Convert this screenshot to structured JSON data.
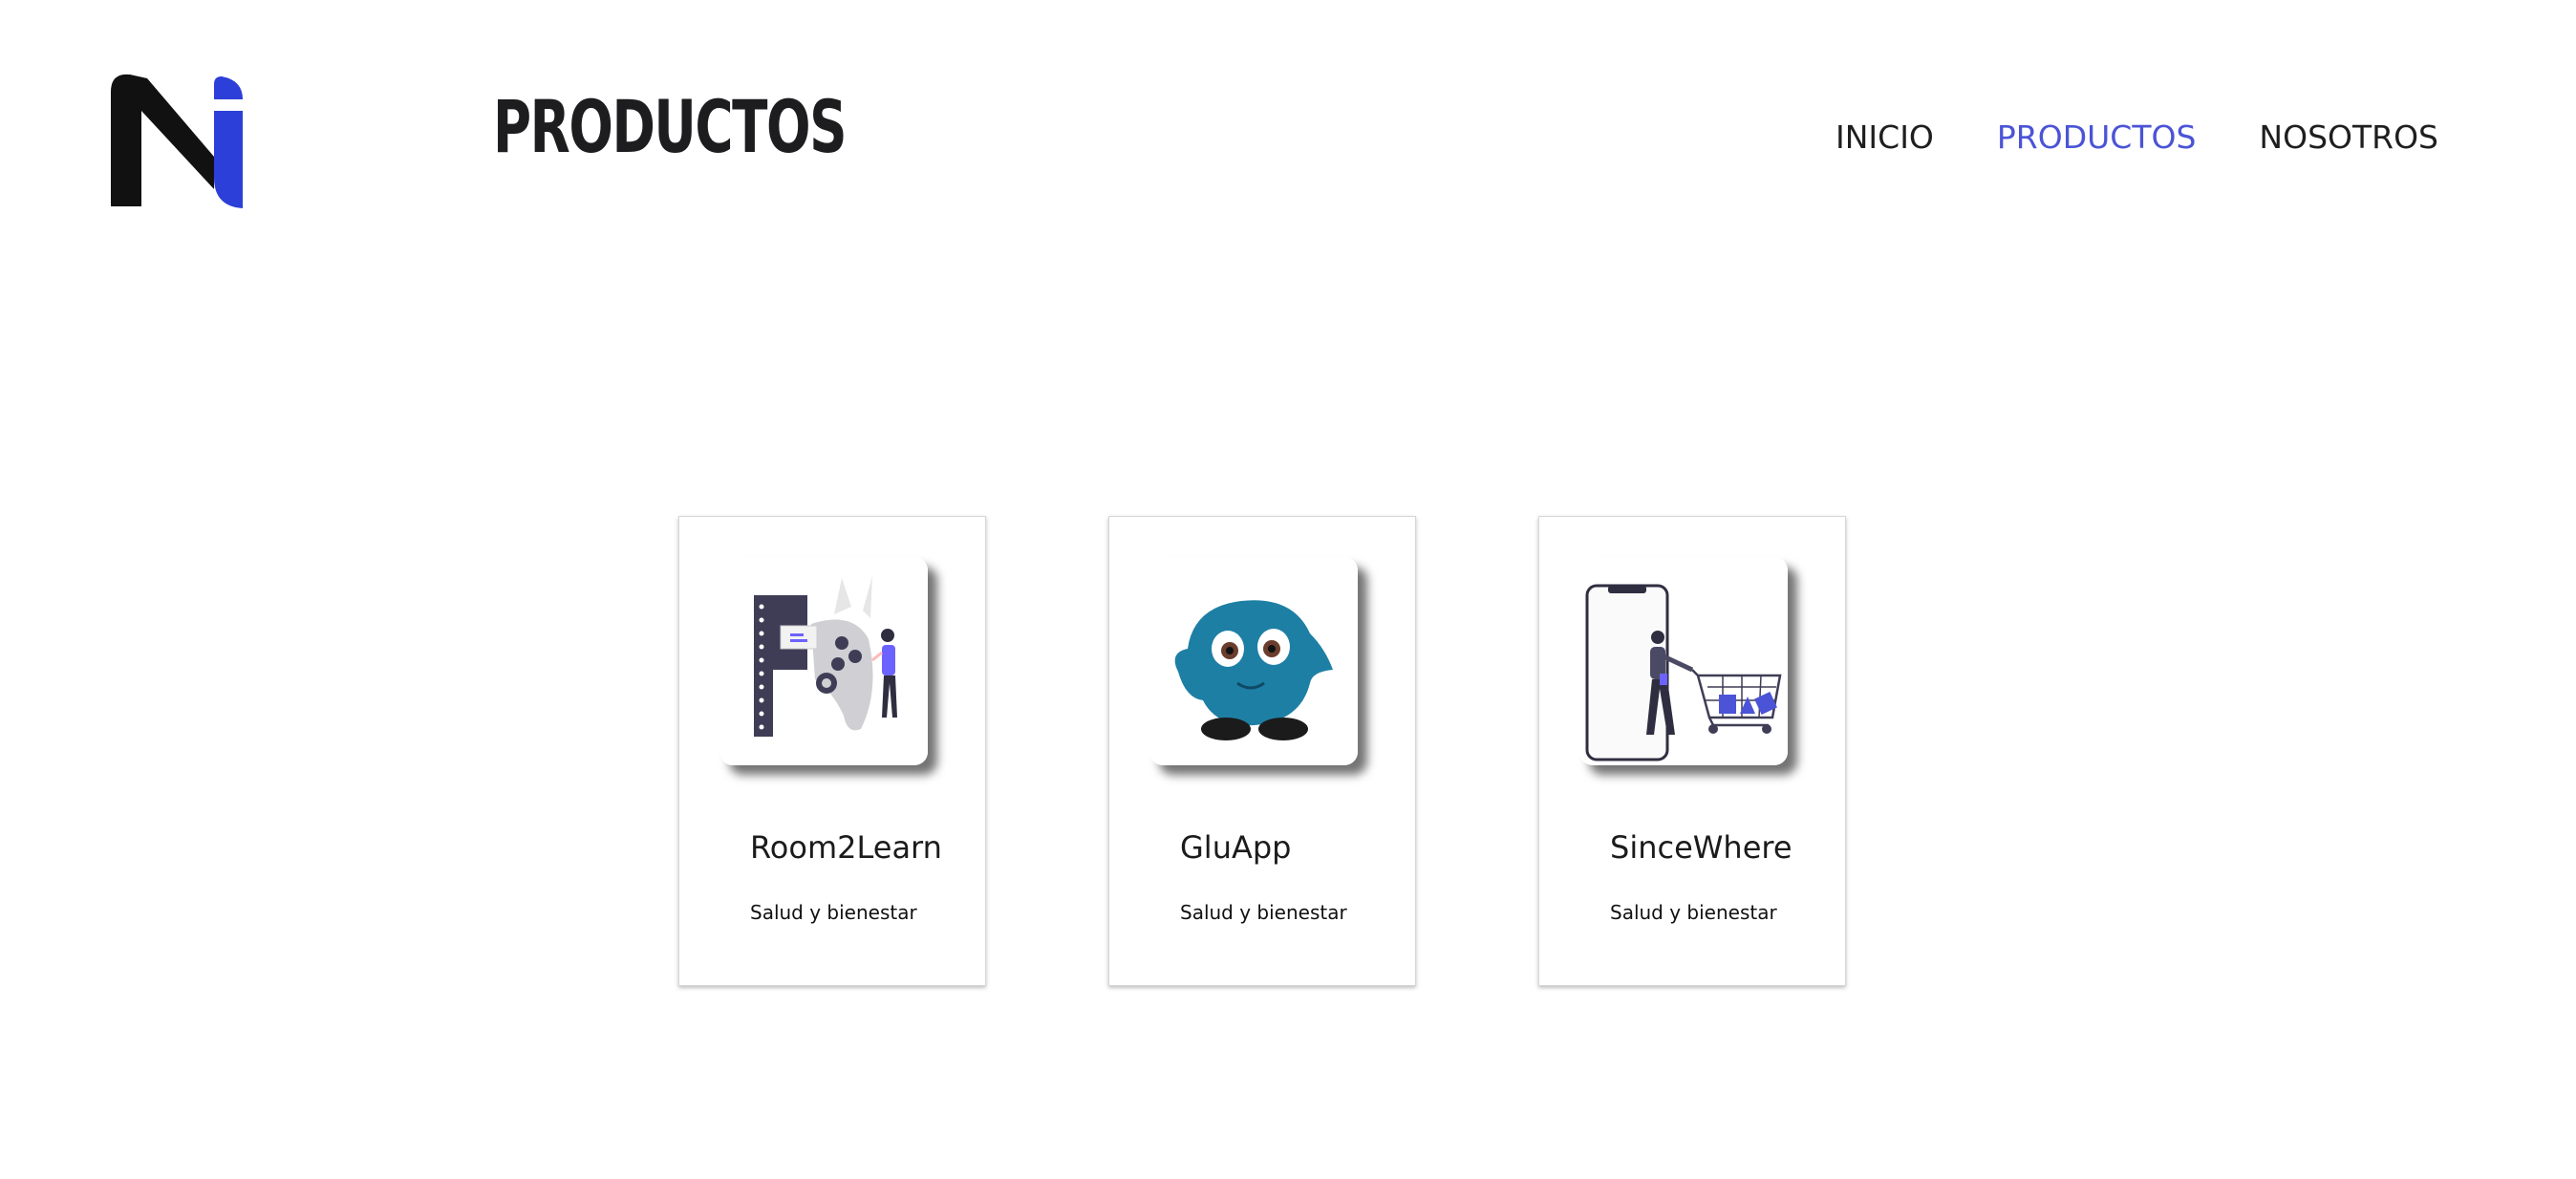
{
  "header": {
    "title": "PRODUCTOS",
    "logo_icon": "ni-logo-icon",
    "brand_colors": {
      "dark": "#111111",
      "accent": "#2c3fd8"
    }
  },
  "nav": {
    "items": [
      {
        "label": "INICIO",
        "active": false
      },
      {
        "label": "PRODUCTOS",
        "active": true
      },
      {
        "label": "NOSOTROS",
        "active": false
      }
    ],
    "active_color": "#4b54d6"
  },
  "products": [
    {
      "name": "Room2Learn",
      "category": "Salud y bienestar",
      "image_icon": "room2learn-illustration-icon"
    },
    {
      "name": "GluApp",
      "category": "Salud y bienestar",
      "image_icon": "gluapp-mascot-icon"
    },
    {
      "name": "SinceWhere",
      "category": "Salud y bienestar",
      "image_icon": "sincewhere-shopping-illustration-icon"
    }
  ]
}
